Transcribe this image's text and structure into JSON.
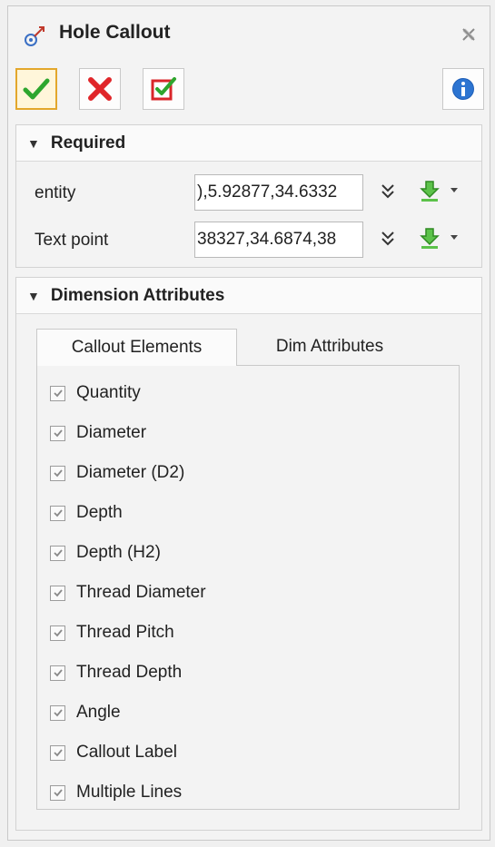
{
  "header": {
    "title": "Hole Callout",
    "title_icon": "hole-callout-icon",
    "close_icon": "close-icon"
  },
  "toolbar": {
    "ok_icon": "green-checkmark-icon",
    "cancel_icon": "red-x-icon",
    "apply_icon": "apply-checkbox-icon",
    "info_icon": "info-icon",
    "accent_color": "#e3a72b"
  },
  "required": {
    "title": "Required",
    "fields": [
      {
        "label": "entity",
        "value": "),5.92877,34.6332"
      },
      {
        "label": "Text point",
        "value": "38327,34.6874,38"
      }
    ]
  },
  "dimension_attributes": {
    "title": "Dimension Attributes",
    "tabs": [
      {
        "label": "Callout Elements",
        "active": true
      },
      {
        "label": "Dim Attributes",
        "active": false
      }
    ],
    "elements": [
      {
        "label": "Quantity",
        "checked": true
      },
      {
        "label": "Diameter",
        "checked": true
      },
      {
        "label": "Diameter (D2)",
        "checked": true
      },
      {
        "label": "Depth",
        "checked": true
      },
      {
        "label": "Depth (H2)",
        "checked": true
      },
      {
        "label": "Thread Diameter",
        "checked": true
      },
      {
        "label": "Thread Pitch",
        "checked": true
      },
      {
        "label": "Thread Depth",
        "checked": true
      },
      {
        "label": "Angle",
        "checked": true
      },
      {
        "label": "Callout Label",
        "checked": true
      },
      {
        "label": "Multiple Lines",
        "checked": true
      }
    ]
  }
}
